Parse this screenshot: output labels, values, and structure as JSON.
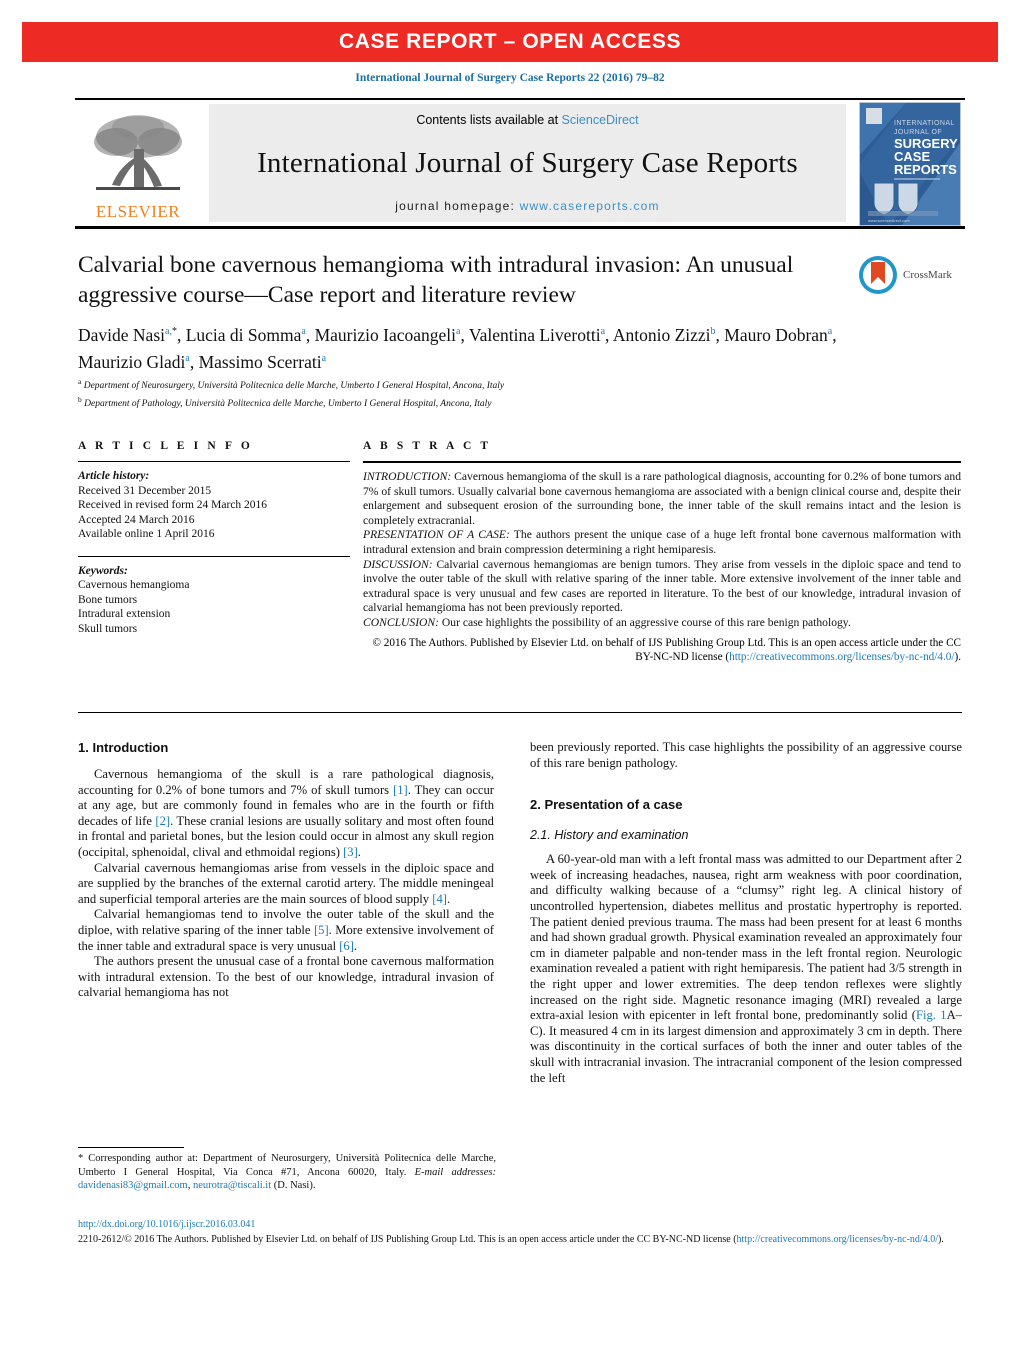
{
  "banner": {
    "label": "CASE REPORT – OPEN ACCESS",
    "color": "#ee2a24"
  },
  "citation": "International Journal of Surgery Case Reports 22 (2016) 79–82",
  "masthead": {
    "contents_prefix": "Contents lists available at ",
    "contents_link": "ScienceDirect",
    "journal_title": "International Journal of Surgery Case Reports",
    "homepage_prefix": "journal homepage: ",
    "homepage_url": "www.casereports.com",
    "publisher_name": "ELSEVIER",
    "cover": {
      "line1": "INTERNATIONAL",
      "line2": "JOURNAL OF",
      "line3": "SURGERY",
      "line4": "CASE",
      "line5": "REPORTS"
    }
  },
  "title": "Calvarial bone cavernous hemangioma with intradural invasion: An unusual aggressive course—Case report and literature review",
  "crossmark_label": "CrossMark",
  "authors": [
    {
      "name": "Davide Nasi",
      "sup": "a,",
      "star": "*",
      "sep": ", "
    },
    {
      "name": "Lucia di Somma",
      "sup": "a",
      "star": "",
      "sep": ", "
    },
    {
      "name": "Maurizio Iacoangeli",
      "sup": "a",
      "star": "",
      "sep": ", "
    },
    {
      "name": "Valentina Liverotti",
      "sup": "a",
      "star": "",
      "sep": ", "
    },
    {
      "name": "Antonio Zizzi",
      "sup": "b",
      "star": "",
      "sep": ", "
    },
    {
      "name": "Mauro Dobran",
      "sup": "a",
      "star": "",
      "sep": ", "
    },
    {
      "name": "Maurizio Gladi",
      "sup": "a",
      "star": "",
      "sep": ", "
    },
    {
      "name": "Massimo Scerrati",
      "sup": "a",
      "star": "",
      "sep": ""
    }
  ],
  "affiliations": [
    {
      "mark": "a",
      "text": "Department of Neurosurgery, Università Politecnica delle Marche, Umberto I General Hospital, Ancona, Italy"
    },
    {
      "mark": "b",
      "text": "Department of Pathology, Università Politecnica delle Marche, Umberto I General Hospital, Ancona, Italy"
    }
  ],
  "article_info": {
    "heading": "A R T I C L E   I N F O",
    "history_label": "Article history:",
    "history": [
      "Received 31 December 2015",
      "Received in revised form 24 March 2016",
      "Accepted 24 March 2016",
      "Available online 1 April 2016"
    ],
    "keywords_label": "Keywords:",
    "keywords": [
      "Cavernous hemangioma",
      "Bone tumors",
      "Intradural extension",
      "Skull tumors"
    ]
  },
  "abstract": {
    "heading": "A B S T R A C T",
    "sections": [
      {
        "lead": "INTRODUCTION:",
        "text": " Cavernous hemangioma of the skull is a rare pathological diagnosis, accounting for 0.2% of bone tumors and 7% of skull tumors. Usually calvarial bone cavernous hemangioma are associated with a benign clinical course and, despite their enlargement and subsequent erosion of the surrounding bone, the inner table of the skull remains intact and the lesion is completely extracranial."
      },
      {
        "lead": "PRESENTATION OF A CASE:",
        "text": " The authors present the unique case of a huge left frontal bone cavernous malformation with intradural extension and brain compression determining a right hemiparesis."
      },
      {
        "lead": "DISCUSSION:",
        "text": " Calvarial cavernous hemangiomas are benign tumors. They arise from vessels in the diploic space and tend to involve the outer table of the skull with relative sparing of the inner table. More extensive involvement of the inner table and extradural space is very unusual and few cases are reported in literature. To the best of our knowledge, intradural invasion of calvarial hemangioma has not been previously reported."
      },
      {
        "lead": "CONCLUSION:",
        "text": " Our case highlights the possibility of an aggressive course of this rare benign pathology."
      }
    ],
    "copyright_text": "© 2016 The Authors. Published by Elsevier Ltd. on behalf of IJS Publishing Group Ltd. This is an open access article under the CC BY-NC-ND license (",
    "copyright_link": "http://creativecommons.org/licenses/by-nc-nd/4.0/",
    "copyright_suffix": ")."
  },
  "body": {
    "left": {
      "section1_heading": "1.  Introduction",
      "paragraphs": [
        {
          "parts": [
            {
              "t": "Cavernous hemangioma of the skull is a rare pathological diagnosis, accounting for 0.2% of bone tumors and 7% of skull tumors "
            },
            {
              "t": "[1]",
              "ref": true
            },
            {
              "t": ". They can occur at any age, but are commonly found in females who are in the fourth or fifth decades of life "
            },
            {
              "t": "[2]",
              "ref": true
            },
            {
              "t": ". These cranial lesions are usually solitary and most often found in frontal and parietal bones, but the lesion could occur in almost any skull region (occipital, sphenoidal, clival and ethmoidal regions) "
            },
            {
              "t": "[3]",
              "ref": true
            },
            {
              "t": "."
            }
          ]
        },
        {
          "parts": [
            {
              "t": "Calvarial cavernous hemangiomas arise from vessels in the diploic space and are supplied by the branches of the external carotid artery. The middle meningeal and superficial temporal arteries are the main sources of blood supply "
            },
            {
              "t": "[4]",
              "ref": true
            },
            {
              "t": "."
            }
          ]
        },
        {
          "parts": [
            {
              "t": "Calvarial hemangiomas tend to involve the outer table of the skull and the diploe, with relative sparing of the inner table "
            },
            {
              "t": "[5]",
              "ref": true
            },
            {
              "t": ". More extensive involvement of the inner table and extradural space is very unusual "
            },
            {
              "t": "[6]",
              "ref": true
            },
            {
              "t": "."
            }
          ]
        },
        {
          "parts": [
            {
              "t": "The authors present the unusual case of a frontal bone cavernous malformation with intradural extension. To the best of our knowledge, intradural invasion of calvarial hemangioma has not"
            }
          ]
        }
      ]
    },
    "right": {
      "continuation": "been previously reported. This case highlights the possibility of an aggressive course of this rare benign pathology.",
      "section2_heading": "2.  Presentation of a case",
      "subsection_heading": "2.1.  History and examination",
      "paragraphs": [
        {
          "parts": [
            {
              "t": "A 60-year-old man with a left frontal mass was admitted to our Department after 2 week of increasing headaches, nausea, right arm weakness with poor coordination, and difficulty walking because of a “clumsy” right leg. A clinical history of uncontrolled hypertension, diabetes mellitus and prostatic hypertrophy is reported. The patient denied previous trauma. The mass had been present for at least 6 months and had shown gradual growth. Physical examination revealed an approximately four cm in diameter palpable and non-tender mass in the left frontal region. Neurologic examination revealed a patient with right hemiparesis. The patient had 3/5 strength in the right upper and lower extremities. The deep tendon reflexes were slightly increased on the right side. Magnetic resonance imaging (MRI) revealed a large extra-axial lesion with epicenter in left frontal bone, predominantly solid ("
            },
            {
              "t": "Fig. 1",
              "ref": true
            },
            {
              "t": "A–C). It measured 4 cm in its largest dimension and approximately 3 cm in depth. There was discontinuity in the cortical surfaces of both the inner and outer tables of the skull with intracranial invasion. The intracranial component of the lesion compressed the left"
            }
          ]
        }
      ]
    }
  },
  "footnote": {
    "star": "*",
    "corresponding_text": " Corresponding author at: Department of Neurosurgery, Università Politecnica delle Marche, Umberto I General Hospital, Via Conca #71, Ancona 60020, Italy.",
    "email_label": "E-mail addresses:",
    "email1": "davidenasi83@gmail.com",
    "email_sep": ", ",
    "email2": "neurotra@tiscali.it",
    "email_suffix": " (D. Nasi)."
  },
  "bottom": {
    "doi": "http://dx.doi.org/10.1016/j.ijscr.2016.03.041",
    "license_prefix": "2210-2612/© 2016 The Authors. Published by Elsevier Ltd. on behalf of IJS Publishing Group Ltd. This is an open access article under the CC BY-NC-ND license (",
    "license_link": "http://creativecommons.org/licenses/by-nc-nd/4.0/",
    "license_suffix": ")."
  }
}
